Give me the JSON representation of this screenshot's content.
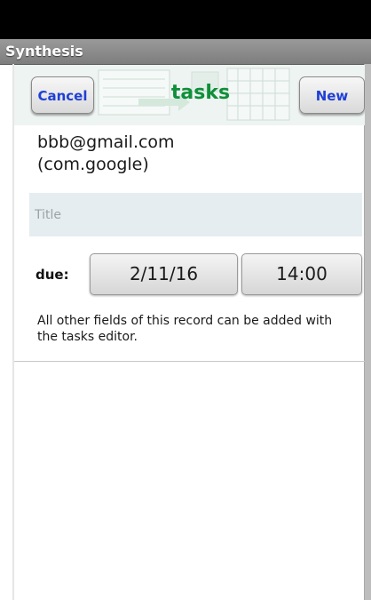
{
  "app": {
    "title": "Synthesis"
  },
  "header": {
    "title": "tasks",
    "cancel_label": "Cancel",
    "new_label": "New"
  },
  "account": {
    "email": "bbb@gmail.com",
    "provider": "(com.google)"
  },
  "form": {
    "title_placeholder": "Title",
    "title_value": "",
    "due_label": "due:",
    "due_date": "2/11/16",
    "due_time": "14:00",
    "note": "All other fields of this record can be added with the tasks editor."
  },
  "colors": {
    "header_title": "#0f8f3a",
    "button_text": "#1f3fd6",
    "titlebar": "#8a8a8a",
    "status_bar": "#000000"
  }
}
